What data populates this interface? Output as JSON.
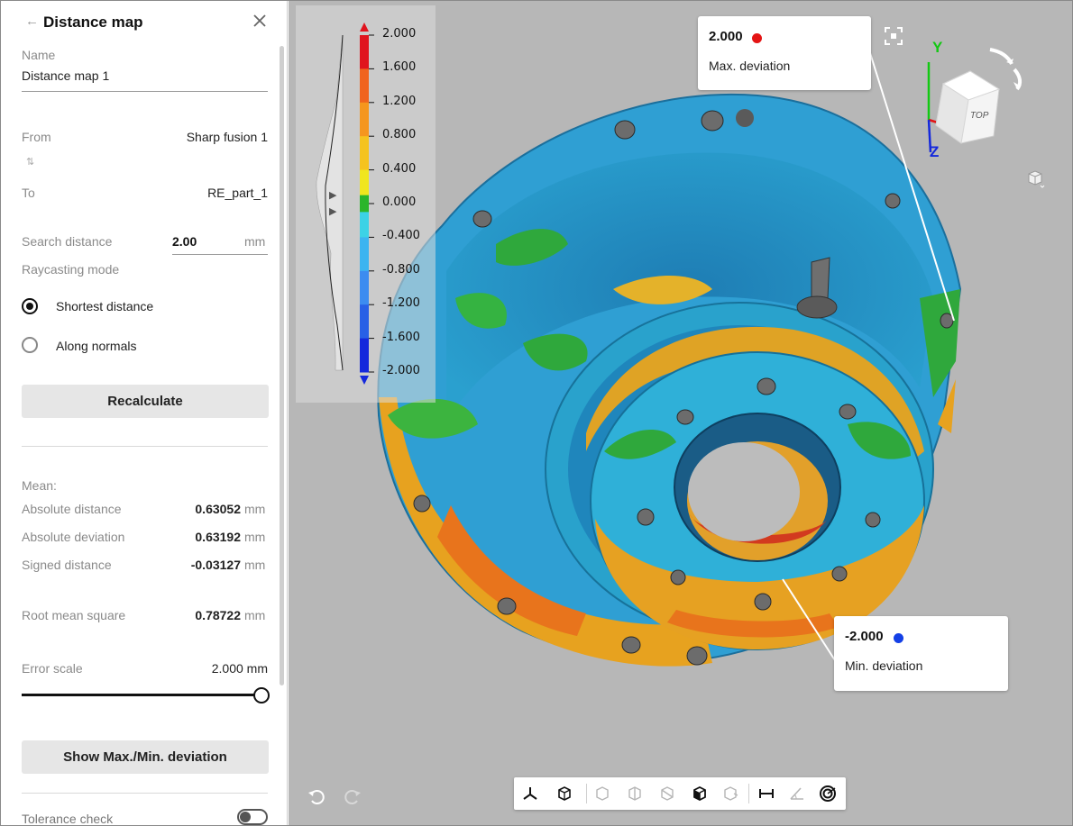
{
  "panel": {
    "title": "Distance map",
    "name_label": "Name",
    "name_value": "Distance map 1",
    "from_label": "From",
    "from_value": "Sharp fusion 1",
    "swap_icon": "swap-vertical-icon",
    "to_label": "To",
    "to_value": "RE_part_1",
    "search_distance_label": "Search distance",
    "search_distance_value": "2.00",
    "search_distance_unit": "mm",
    "raycasting_label": "Raycasting mode",
    "raycasting_options": [
      {
        "label": "Shortest distance",
        "selected": true
      },
      {
        "label": "Along normals",
        "selected": false
      }
    ],
    "recalculate_label": "Recalculate",
    "mean_label": "Mean:",
    "stats": [
      {
        "label": "Absolute distance",
        "value": "0.63052",
        "unit": "mm"
      },
      {
        "label": "Absolute deviation",
        "value": "0.63192",
        "unit": "mm"
      },
      {
        "label": "Signed distance",
        "value": "-0.03127",
        "unit": "mm"
      },
      {
        "label": "Root mean square",
        "value": "0.78722",
        "unit": "mm"
      }
    ],
    "error_scale_label": "Error scale",
    "error_scale_value": "2.000 mm",
    "error_scale_fraction": 1.0,
    "show_maxmin_label": "Show Max./Min. deviation",
    "tolerance_check_label": "Tolerance check",
    "tolerance_check_on": false
  },
  "legend": {
    "ticks": [
      "2.000",
      "1.600",
      "1.200",
      "0.800",
      "0.400",
      "0.000",
      "-0.400",
      "-0.800",
      "-1.200",
      "-1.600",
      "-2.000"
    ],
    "band_colors": [
      "#e0141e",
      "#f0641e",
      "#f5961e",
      "#f5c31e",
      "#f0e61e",
      "#2bb52b",
      "#3cd2e6",
      "#3cb4f0",
      "#3c8cf0",
      "#2860e6",
      "#1428dc"
    ],
    "top_arrow_color": "#e0141e",
    "bottom_arrow_color": "#1428dc"
  },
  "callouts": {
    "max": {
      "value": "2.000",
      "label": "Max. deviation",
      "color": "#e41414"
    },
    "min": {
      "value": "-2.000",
      "label": "Min. deviation",
      "color": "#1440e6"
    }
  },
  "view_cube": {
    "face_label": "TOP",
    "axis_y": "Y",
    "axis_z": "Z"
  },
  "toolbar_icons": [
    "axes-icon",
    "iso-view-icon",
    "front-view-icon",
    "side-view-icon",
    "back-view-icon",
    "solid-box-icon",
    "cut-view-icon",
    "measure-distance-icon",
    "measure-angle-icon",
    "target-icon"
  ],
  "colors": {
    "viewport_bg": "#b7b7b7",
    "panel_bg": "#ffffff",
    "button_bg": "#e6e6e6"
  }
}
